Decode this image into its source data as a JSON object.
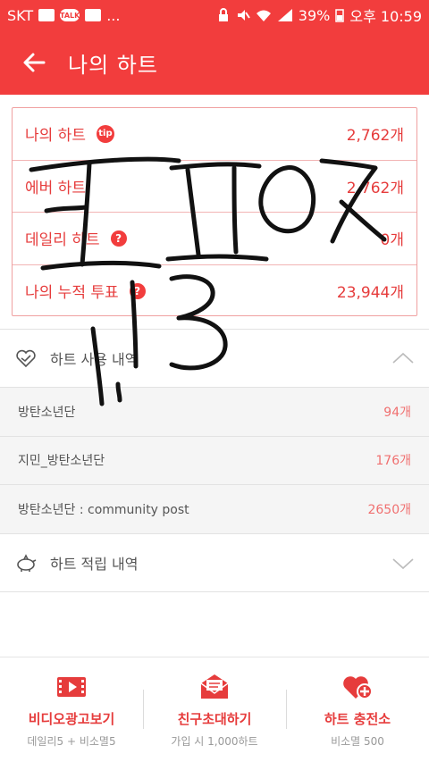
{
  "status_bar": {
    "carrier": "SKT",
    "overflow": "...",
    "battery": "39%",
    "time": "오후 10:59"
  },
  "appbar": {
    "back_icon": "arrow-left-icon",
    "title": "나의 하트"
  },
  "hearts": {
    "rows": [
      {
        "label": "나의 하트",
        "badge": "tip",
        "value": "2,762개"
      },
      {
        "label": "에버 하트",
        "badge": "",
        "value": "2,762개"
      },
      {
        "label": "데일리 하트",
        "badge": "?",
        "value": "0개"
      },
      {
        "label": "나의 누적 투표",
        "badge": "?",
        "value": "23,944개"
      }
    ]
  },
  "usage": {
    "title": "하트 사용 내역",
    "items": [
      {
        "name": "방탄소년단",
        "amount": "94개"
      },
      {
        "name": "지민_방탄소년단",
        "amount": "176개"
      },
      {
        "name": "방탄소년단 : community post",
        "amount": "2650개"
      }
    ]
  },
  "earn": {
    "title": "하트 적립 내역"
  },
  "bottom": {
    "video": {
      "label": "비디오광고보기",
      "sub": "데일리5 + 비소멸5"
    },
    "invite": {
      "label": "친구초대하기",
      "sub": "가입 시 1,000하트"
    },
    "charge": {
      "label": "하트 충전소",
      "sub": "비소멸 500"
    }
  },
  "colors": {
    "accent": "#f23d3d",
    "text_red": "#e63c3c",
    "scribble": "#111111"
  }
}
